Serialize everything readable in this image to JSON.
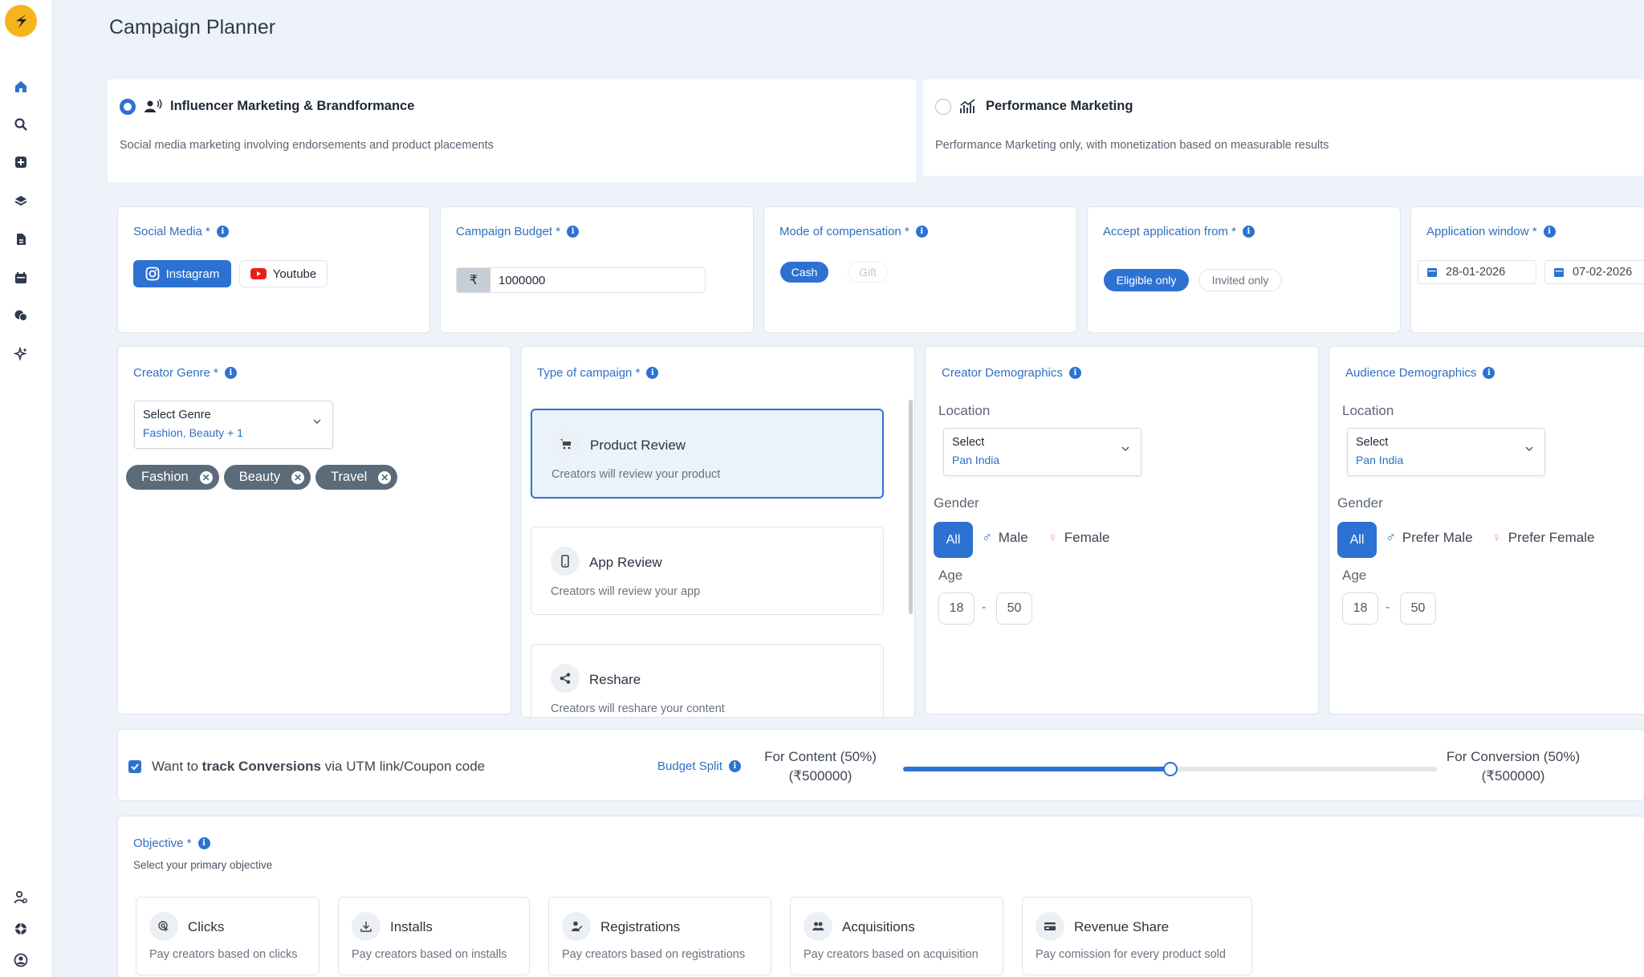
{
  "page": {
    "title": "Campaign Planner"
  },
  "sidebar": {
    "items": [
      {
        "icon": "home-icon"
      },
      {
        "icon": "search-icon"
      },
      {
        "icon": "add-icon"
      },
      {
        "icon": "layers-icon"
      },
      {
        "icon": "document-icon"
      },
      {
        "icon": "calendar-icon"
      },
      {
        "icon": "chat-icon"
      },
      {
        "icon": "sparkle-icon"
      }
    ],
    "bottom_items": [
      {
        "icon": "user-settings-icon"
      },
      {
        "icon": "support-icon"
      },
      {
        "icon": "profile-icon"
      }
    ]
  },
  "marketing_types": [
    {
      "title": "Influencer Marketing & Brandformance",
      "description": "Social media marketing involving endorsements and product placements",
      "selected": true
    },
    {
      "title": "Performance Marketing",
      "description": "Performance Marketing only, with monetization based on measurable results",
      "selected": false
    }
  ],
  "social_media": {
    "label": "Social Media *",
    "options": [
      "Instagram",
      "Youtube"
    ],
    "selected": "Instagram"
  },
  "budget": {
    "label": "Campaign Budget *",
    "currency": "₹",
    "value": "1000000"
  },
  "compensation": {
    "label": "Mode of compensation *",
    "options": [
      "Cash",
      "Gift"
    ],
    "selected": "Cash"
  },
  "accept_from": {
    "label": "Accept application from *",
    "options": [
      "Eligible only",
      "Invited only"
    ],
    "selected": "Eligible only"
  },
  "application_window": {
    "label": "Application window *",
    "start": "28-01-2026",
    "end": "07-02-2026"
  },
  "creator_genre": {
    "label": "Creator Genre *",
    "select_placeholder": "Select Genre",
    "select_value": "Fashion, Beauty + 1",
    "chips": [
      "Fashion",
      "Beauty",
      "Travel"
    ]
  },
  "campaign_type": {
    "label": "Type of campaign *",
    "options": [
      {
        "title": "Product Review",
        "description": "Creators will review your product",
        "selected": true
      },
      {
        "title": "App Review",
        "description": "Creators will review your app",
        "selected": false
      },
      {
        "title": "Reshare",
        "description": "Creators will reshare your content",
        "selected": false
      }
    ]
  },
  "creator_demographics": {
    "label": "Creator Demographics",
    "location_label": "Location",
    "location_select": "Select",
    "location_value": "Pan India",
    "gender_label": "Gender",
    "gender_options": [
      "All",
      "Male",
      "Female"
    ],
    "age_label": "Age",
    "age_min": "18",
    "age_max": "50"
  },
  "audience_demographics": {
    "label": "Audience Demographics",
    "location_label": "Location",
    "location_select": "Select",
    "location_value": "Pan India",
    "gender_label": "Gender",
    "gender_options": [
      "All",
      "Prefer Male",
      "Prefer Female"
    ],
    "age_label": "Age",
    "age_min": "18",
    "age_max": "50"
  },
  "conversions": {
    "checked": true,
    "text_prefix": "Want to ",
    "text_bold": "track Conversions",
    "text_suffix": " via UTM link/Coupon code",
    "budget_split_label": "Budget Split",
    "content_label": "For Content (50%)",
    "content_amount": "(₹500000)",
    "conversion_label": "For Conversion (50%)",
    "conversion_amount": "(₹500000)",
    "split_percent": 50
  },
  "objective": {
    "label": "Objective *",
    "subtitle": "Select your primary objective",
    "options": [
      {
        "title": "Clicks",
        "description": "Pay creators based on clicks"
      },
      {
        "title": "Installs",
        "description": "Pay creators based on installs"
      },
      {
        "title": "Registrations",
        "description": "Pay creators based on registrations"
      },
      {
        "title": "Acquisitions",
        "description": "Pay creators based on acquisition"
      },
      {
        "title": "Revenue Share",
        "description": "Pay comission for every product sold"
      }
    ]
  },
  "colors": {
    "accent": "#2d72d2",
    "label_blue": "#2f6fc0",
    "chip_gray": "#5b6b7a"
  }
}
